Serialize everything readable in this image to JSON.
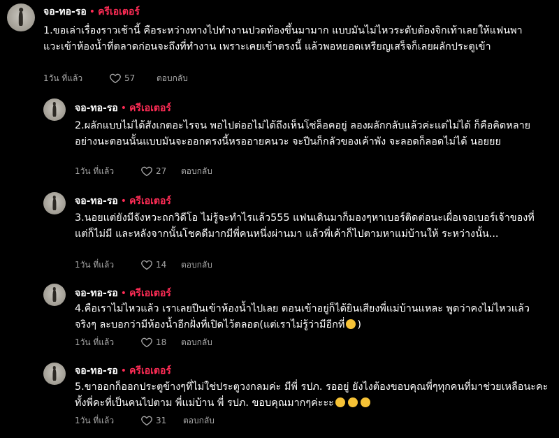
{
  "comments": [
    {
      "username": "จอ-ทอ-รอ",
      "separator": "•",
      "badge": "ครีเอเตอร์",
      "text": "1.ขอเล่าเรื่องราวเช้านี้ คือระหว่างทางไปทำงานปวดท้องขึ้นมามาก แบบมันไม่ไหวระดับต้องจิกเท้าเลยให้แฟนพาแวะเข้าห้องน้ำที่ตลาดก่อนจะถึงที่ทำงาน เพราะเคยเข้าตรงนี้ แล้วพอหยอดเหรียญเสร็จก็เลยผลักประตูเข้า",
      "time": "1วัน ที่แล้ว",
      "likes": "57",
      "reply": "ตอบกลับ"
    },
    {
      "username": "จอ-ทอ-รอ",
      "separator": "•",
      "badge": "ครีเอเตอร์",
      "text": "2.ผลักแบบไม่ได้สังเกตอะไรจน พอไปต่ออไม่ได้ถึงเห็นโซ่ล็อคอยู่ ลองผลักกลับแล้วค่ะแต่ไม่ได้ ก็คือคิดหลายอย่างนะตอนนั้นแบบมันจะออกตรงนี้หรออายคนวะ จะปีนก็กลัวของเค้าพัง จะลอดก็ลอดไม่ได้ นอยยย",
      "time": "1วัน ที่แล้ว",
      "likes": "27",
      "reply": "ตอบกลับ"
    },
    {
      "username": "จอ-ทอ-รอ",
      "separator": "•",
      "badge": "ครีเอเตอร์",
      "text": "3.นอยแต่ยังมีจังหวะถกวิดีโอ ไม่รู้จะทำไรแล้ว555 แฟนเดินมาก็มองๆหาเบอร์ติดต่อนะเผื่อเจอเบอร์เจ้าของที่ แต่ก็ไม่มี และหลังจากนั้นโชคดีมากมีพี่คนหนึ่งผ่านมา แล้วพี่เค้าก็ไปตามหาแม่บ้านให้ ระหว่างนั้น...",
      "time": "1วัน ที่แล้ว",
      "likes": "14",
      "reply": "ตอบกลับ"
    },
    {
      "username": "จอ-ทอ-รอ",
      "separator": "•",
      "badge": "ครีเอเตอร์",
      "text": "4.คือเราไม่ไหวแล้ว เราเลยปีนเข้าห้องน้ำไปเลย ตอนเข้าอยู่ก็ได้ยินเสียงพี่แม่บ้านแหละ พูดว่าคงไม่ไหวแล้วจริงๆ ละบอกว่ามีห้องน้ำอีกฝั่งที่เปิดไว้ตลอด(แต่เราไม่รู้ว่ามีอีกที่",
      "text_end": ")",
      "time": "1วัน ที่แล้ว",
      "likes": "18",
      "reply": "ตอบกลับ"
    },
    {
      "username": "จอ-ทอ-รอ",
      "separator": "•",
      "badge": "ครีเอเตอร์",
      "text": "5.ขาออกก็ออกประตูข้างๆที่ไม่ใช่ประตูวงกลมค่ะ มีพี่ รปภ. รออยู่ ยังไงต้องขอบคุณพี่ๆทุกคนที่มาช่วยเหลือนะคะ ทั้งพี่คะที่เป็นคนไปตาม พี่แม่บ้าน พี่ รปภ. ขอบคุณมากๆค่ะะะ",
      "time": "1วัน ที่แล้ว",
      "likes": "31",
      "reply": "ตอบกลับ"
    }
  ],
  "colors": {
    "background": "#000000",
    "creator_badge": "#fe2c55",
    "meta_text": "#a8a8a8"
  }
}
